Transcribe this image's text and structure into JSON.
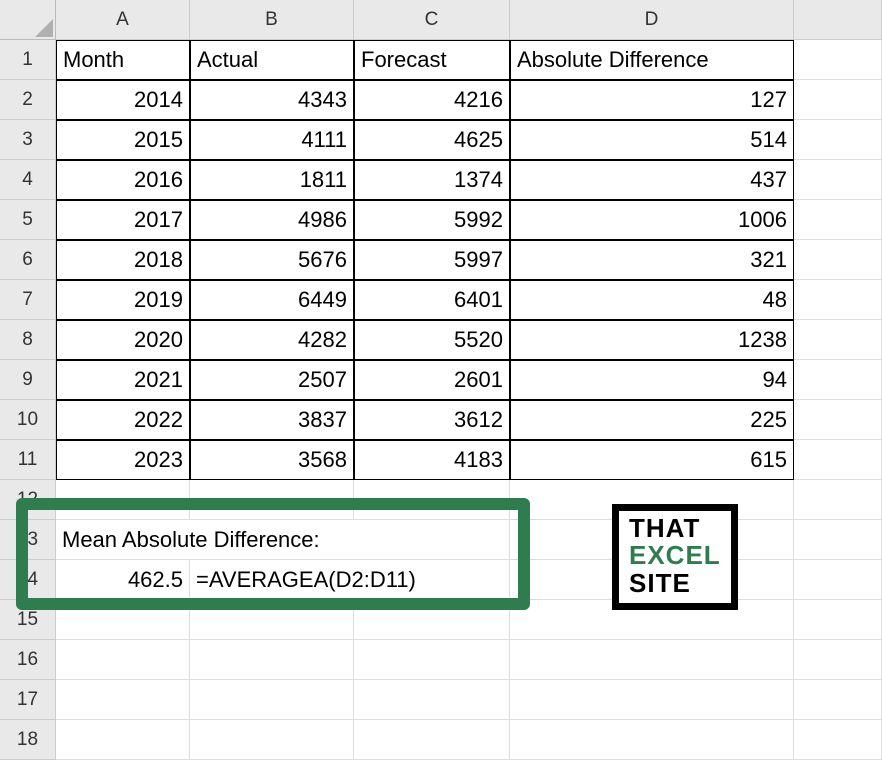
{
  "columns": [
    "A",
    "B",
    "C",
    "D"
  ],
  "last_column_fragment": "",
  "rows": [
    "1",
    "2",
    "3",
    "4",
    "5",
    "6",
    "7",
    "8",
    "9",
    "10",
    "11",
    "12",
    "13",
    "14",
    "15",
    "16",
    "17",
    "18"
  ],
  "headers": {
    "A": "Month",
    "B": "Actual",
    "C": "Forecast",
    "D": "Absolute Difference"
  },
  "data": [
    {
      "A": "2014",
      "B": "4343",
      "C": "4216",
      "D": "127"
    },
    {
      "A": "2015",
      "B": "4111",
      "C": "4625",
      "D": "514"
    },
    {
      "A": "2016",
      "B": "1811",
      "C": "1374",
      "D": "437"
    },
    {
      "A": "2017",
      "B": "4986",
      "C": "5992",
      "D": "1006"
    },
    {
      "A": "2018",
      "B": "5676",
      "C": "5997",
      "D": "321"
    },
    {
      "A": "2019",
      "B": "6449",
      "C": "6401",
      "D": "48"
    },
    {
      "A": "2020",
      "B": "4282",
      "C": "5520",
      "D": "1238"
    },
    {
      "A": "2021",
      "B": "2507",
      "C": "2601",
      "D": "94"
    },
    {
      "A": "2022",
      "B": "3837",
      "C": "3612",
      "D": "225"
    },
    {
      "A": "2023",
      "B": "3568",
      "C": "4183",
      "D": "615"
    }
  ],
  "label_row13": "Mean Absolute Difference:",
  "result_value": "462.5",
  "result_formula": "=AVERAGEA(D2:D11)",
  "logo": {
    "l1": "THAT",
    "l2": "EXCEL",
    "l3": "SITE"
  }
}
